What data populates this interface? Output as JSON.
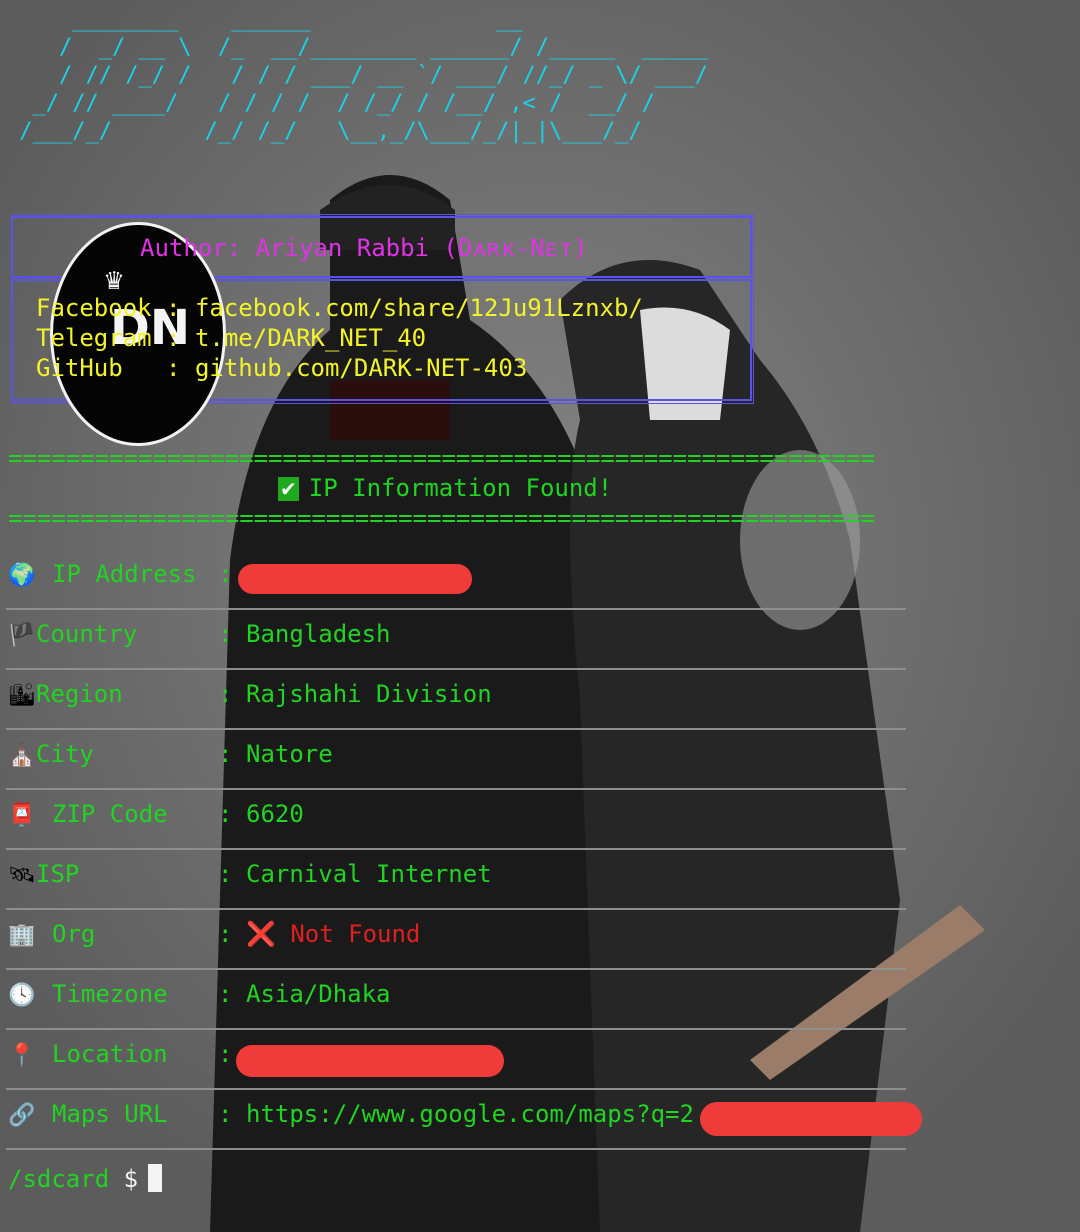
{
  "banner": {
    "title": "IP Tracker",
    "ascii_lines": [
      "     ________    ______              __",
      "    /  _/ __ \\  /_  __/________ ______/ /_____  _____",
      "    / // /_/ /   / / / ___/ __ `/ ___/ //_/ _ \\/ ___/",
      "  _/ // ____/   / / / /  / /_/ / /__/ ,< /  __/ /",
      " /___/_/       /_/ /_/   \\__,_/\\___/_/|_|\\___/_/"
    ],
    "color": "#19d3e6"
  },
  "author": {
    "line": "Author: Ariyan Rabbi (Dᴀʀᴋ-Nᴇᴛ)",
    "color": "#e033e6"
  },
  "links": {
    "facebook": "Facebook : facebook.com/share/12Ju91Lznxb/",
    "telegram": "Telegram : t.me/DARK_NET_40",
    "github": "GitHub   : github.com/DARK-NET-403",
    "color": "#f3f32a"
  },
  "logo": {
    "text": "DN",
    "crown": "♛"
  },
  "separator": "============================================================",
  "status": {
    "check_icon": "✔",
    "text": "IP Information Found!"
  },
  "rows": [
    {
      "icon": "🌍",
      "label": "IP Address",
      "value": "",
      "redacted": true
    },
    {
      "icon": "🏴",
      "label": "Country",
      "value": "Bangladesh"
    },
    {
      "icon": "🏙",
      "label": "Region",
      "value": "Rajshahi Division"
    },
    {
      "icon": "⛪",
      "label": "City",
      "value": "Natore"
    },
    {
      "icon": "📮",
      "label": "ZIP Code",
      "value": "6620"
    },
    {
      "icon": "🛰",
      "label": "ISP",
      "value": "Carnival Internet"
    },
    {
      "icon": "🏢",
      "label": "Org",
      "value": "❌ Not Found",
      "error": true
    },
    {
      "icon": "🕓",
      "label": "Timezone",
      "value": "Asia/Dhaka"
    },
    {
      "icon": "📍",
      "label": "Location",
      "value": "",
      "redacted": true
    },
    {
      "icon": "🔗",
      "label": "Maps URL",
      "value": "https://www.google.com/maps?q=2",
      "redacted_partial": true
    }
  ],
  "prompt": {
    "path": "/sdcard",
    "symbol": "$"
  },
  "colors": {
    "terminal_green": "#21d421",
    "error_red": "#e02020",
    "redaction": "#f03b3b"
  }
}
